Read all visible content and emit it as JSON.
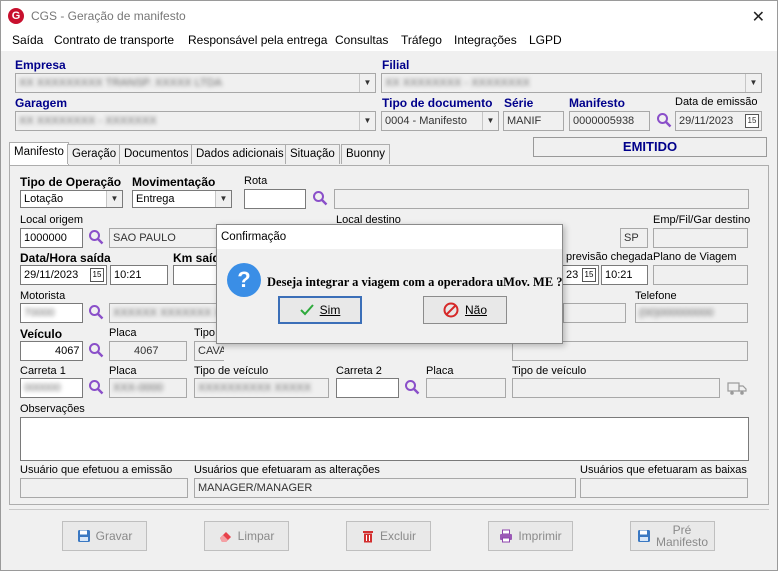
{
  "window": {
    "title": "CGS - Geração de manifesto",
    "close_glyph": "✕"
  },
  "menu": [
    "Saída",
    "Contrato de transporte",
    "Responsável pela entrega",
    "Consultas",
    "Tráfego",
    "Integrações",
    "LGPD"
  ],
  "header": {
    "empresa_label": "Empresa",
    "empresa_value": "XX XXXXXXXXX TRANSP. XXXXX LTDA",
    "filial_label": "Filial",
    "filial_value": "XX XXXXXXXX - XXXXXXXX",
    "garagem_label": "Garagem",
    "garagem_value": "XX XXXXXXXX - XXXXXXX",
    "tipo_doc_label": "Tipo de documento",
    "tipo_doc_value": "0004 - Manifesto",
    "serie_label": "Série",
    "serie_value": "MANIF",
    "manifesto_label": "Manifesto",
    "manifesto_value": "0000005938",
    "data_emissao_label": "Data de emissão",
    "data_emissao_value": "29/11/2023",
    "status": "EMITIDO"
  },
  "tabs": [
    "Manifesto",
    "Geração",
    "Documentos",
    "Dados adicionais",
    "Situação",
    "Buonny"
  ],
  "form": {
    "tipo_operacao_label": "Tipo de Operação",
    "tipo_operacao_value": "Lotação",
    "movimentacao_label": "Movimentação",
    "movimentacao_value": "Entrega",
    "rota_label": "Rota",
    "local_origem_label": "Local origem",
    "local_origem_code": "1000000",
    "local_origem_city": "SAO PAULO",
    "local_destino_label": "Local destino",
    "uf_destino": "SP",
    "emp_fil_gar_label": "Emp/Fil/Gar destino",
    "data_hora_saida_label": "Data/Hora saída",
    "data_saida": "29/11/2023",
    "hora_saida": "10:21",
    "km_saida_label": "Km saíd",
    "previsao_chegada_label": "previsão chegada",
    "data_chegada": "23",
    "hora_chegada": "10:21",
    "plano_viagem_label": "Plano de Viagem",
    "motorista_label": "Motorista",
    "motorista_code": "70000",
    "motorista_name": "XXXXXX XXXXXXX XXXXXXX",
    "telefone_label": "Telefone",
    "telefone_value": "(00)000000000",
    "veiculo_label": "Veículo",
    "veiculo_code": "4067",
    "placa_label": "Placa",
    "placa_value": "4067",
    "tipo_label": "Tipo",
    "tipo_value": "CAVALO TRUCADO",
    "carreta1_label": "Carreta 1",
    "carreta1_value": "000000",
    "placa2_label": "Placa",
    "placa2_value": "XXX-0000",
    "tipo_veiculo_label": "Tipo de veículo",
    "tipo_veiculo_value": "XXXXXXXXXX XXXXX",
    "carreta2_label": "Carreta 2",
    "placa3_label": "Placa",
    "tipo_veiculo2_label": "Tipo de veículo",
    "observacoes_label": "Observações",
    "usuario_emissao_label": "Usuário que efetuou a emissão",
    "usuarios_alteracoes_label": "Usuários que efetuaram as alterações",
    "usuarios_alteracoes_value": "MANAGER/MANAGER",
    "usuarios_baixas_label": "Usuários que efetuaram as baixas"
  },
  "buttons": {
    "gravar": "Gravar",
    "limpar": "Limpar",
    "excluir": "Excluir",
    "imprimir": "Imprimir",
    "pre_manifesto_1": "Pré",
    "pre_manifesto_2": "Manifesto"
  },
  "dialog": {
    "title": "Confirmação",
    "message": "Deseja integrar a viagem com a operadora uMov. ME ?",
    "yes": "Sim",
    "no": "Não",
    "icon_glyph": "?"
  }
}
